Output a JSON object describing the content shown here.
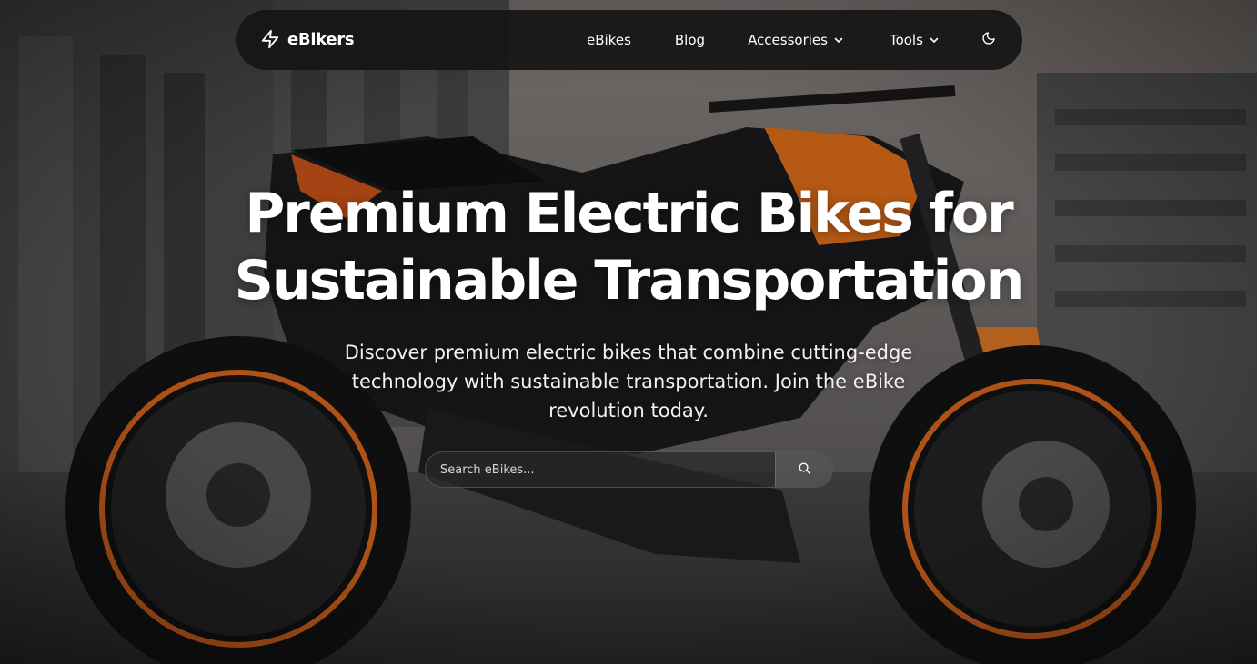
{
  "nav": {
    "brand": "eBikers",
    "links": [
      {
        "label": "eBikes"
      },
      {
        "label": "Blog"
      },
      {
        "label": "Accessories"
      },
      {
        "label": "Tools"
      }
    ]
  },
  "hero": {
    "title": "Premium Electric Bikes for Sustainable Transportation",
    "subtitle": "Discover premium electric bikes that combine cutting-edge technology with sustainable transportation. Join the eBike revolution today."
  },
  "search": {
    "placeholder": "Search eBikes..."
  },
  "colors": {
    "nav_bg": "#161616",
    "accent_orange": "#e8721c",
    "text": "#ffffff"
  },
  "icons": {
    "brand": "lightning-bolt-icon",
    "theme": "moon-icon",
    "search": "search-icon",
    "dropdown": "chevron-down-icon"
  }
}
